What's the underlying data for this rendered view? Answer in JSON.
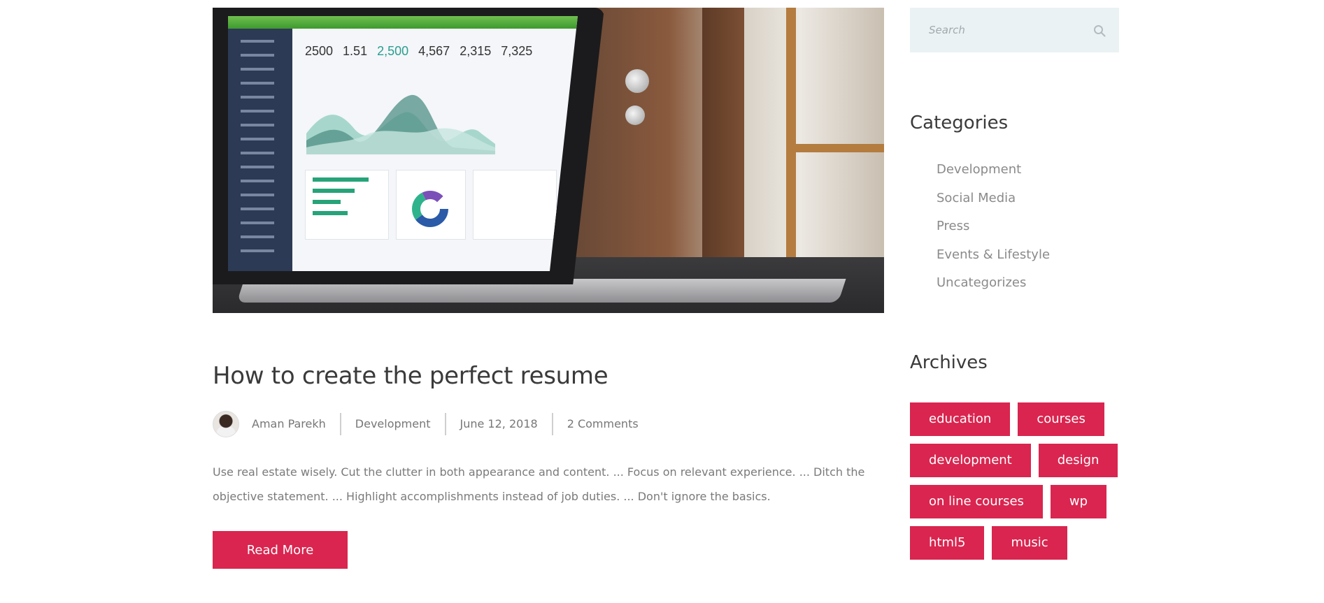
{
  "post": {
    "image_alt": "Laptop showing an analytics dashboard",
    "screen_stats": [
      "2500",
      "1.51",
      "2,500",
      "4,567",
      "2,315",
      "7,325"
    ],
    "title": "How to create the perfect resume",
    "author": "Aman Parekh",
    "category": "Development",
    "date": "June 12, 2018",
    "comments": "2 Comments",
    "excerpt": "Use real estate wisely. Cut the clutter in both appearance and content. ... Focus on relevant experience. ... Ditch the objective statement. ... Highlight accomplishments instead of job duties. ... Don't ignore the basics.",
    "read_more_label": "Read More"
  },
  "sidebar": {
    "search": {
      "placeholder": "Search",
      "icon": "search-icon"
    },
    "categories": {
      "title": "Categories",
      "items": [
        {
          "label": "Development"
        },
        {
          "label": "Social Media"
        },
        {
          "label": "Press"
        },
        {
          "label": "Events & Lifestyle"
        },
        {
          "label": "Uncategorizes"
        }
      ]
    },
    "archives": {
      "title": "Archives",
      "tags": [
        {
          "label": "education"
        },
        {
          "label": "courses"
        },
        {
          "label": "development"
        },
        {
          "label": "design"
        },
        {
          "label": "on line courses"
        },
        {
          "label": "wp"
        },
        {
          "label": "html5"
        },
        {
          "label": "music"
        }
      ]
    }
  },
  "colors": {
    "accent": "#d9254f",
    "search_bg": "#eaf2f4",
    "muted_text": "#8a8a8a"
  }
}
